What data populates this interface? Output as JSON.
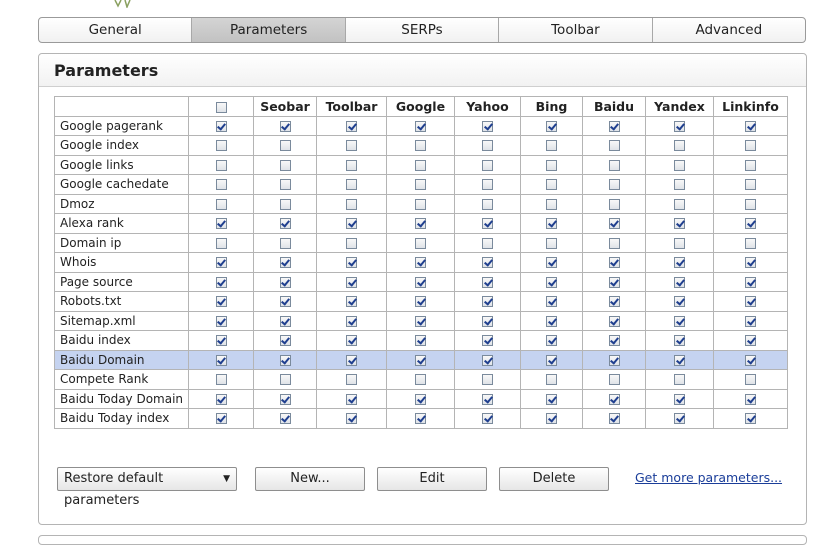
{
  "tabs": [
    {
      "label": "General",
      "active": false
    },
    {
      "label": "Parameters",
      "active": true
    },
    {
      "label": "SERPs",
      "active": false
    },
    {
      "label": "Toolbar",
      "active": false
    },
    {
      "label": "Advanced",
      "active": false
    }
  ],
  "panel": {
    "title": "Parameters"
  },
  "table": {
    "columns": [
      "Seobar",
      "Toolbar",
      "Google",
      "Yahoo",
      "Bing",
      "Baidu",
      "Yandex",
      "Linkinfo"
    ],
    "header_checkbox_checked": false,
    "rows": [
      {
        "name": "Google pagerank",
        "enabled": true,
        "cols": [
          true,
          true,
          true,
          true,
          true,
          true,
          true,
          true
        ]
      },
      {
        "name": "Google index",
        "enabled": false,
        "cols": [
          false,
          false,
          false,
          false,
          false,
          false,
          false,
          false
        ]
      },
      {
        "name": "Google links",
        "enabled": false,
        "cols": [
          false,
          false,
          false,
          false,
          false,
          false,
          false,
          false
        ]
      },
      {
        "name": "Google cachedate",
        "enabled": false,
        "cols": [
          false,
          false,
          false,
          false,
          false,
          false,
          false,
          false
        ]
      },
      {
        "name": "Dmoz",
        "enabled": false,
        "cols": [
          false,
          false,
          false,
          false,
          false,
          false,
          false,
          false
        ]
      },
      {
        "name": "Alexa rank",
        "enabled": true,
        "cols": [
          true,
          true,
          true,
          true,
          true,
          true,
          true,
          true
        ]
      },
      {
        "name": "Domain ip",
        "enabled": false,
        "cols": [
          false,
          false,
          false,
          false,
          false,
          false,
          false,
          false
        ]
      },
      {
        "name": "Whois",
        "enabled": true,
        "cols": [
          true,
          true,
          true,
          true,
          true,
          true,
          true,
          true
        ]
      },
      {
        "name": "Page source",
        "enabled": true,
        "cols": [
          true,
          true,
          true,
          true,
          true,
          true,
          true,
          true
        ]
      },
      {
        "name": "Robots.txt",
        "enabled": true,
        "cols": [
          true,
          true,
          true,
          true,
          true,
          true,
          true,
          true
        ]
      },
      {
        "name": "Sitemap.xml",
        "enabled": true,
        "cols": [
          true,
          true,
          true,
          true,
          true,
          true,
          true,
          true
        ]
      },
      {
        "name": "Baidu index",
        "enabled": true,
        "cols": [
          true,
          true,
          true,
          true,
          true,
          true,
          true,
          true
        ]
      },
      {
        "name": "Baidu Domain",
        "enabled": true,
        "cols": [
          true,
          true,
          true,
          true,
          true,
          true,
          true,
          true
        ],
        "highlighted": true
      },
      {
        "name": "Compete Rank",
        "enabled": false,
        "cols": [
          false,
          false,
          false,
          false,
          false,
          false,
          false,
          false
        ]
      },
      {
        "name": "Baidu Today Domain",
        "enabled": true,
        "cols": [
          true,
          true,
          true,
          true,
          true,
          true,
          true,
          true
        ]
      },
      {
        "name": "Baidu Today index",
        "enabled": true,
        "cols": [
          true,
          true,
          true,
          true,
          true,
          true,
          true,
          true
        ]
      }
    ]
  },
  "buttons": {
    "restore": "Restore default parameters",
    "new": "New...",
    "edit": "Edit",
    "delete": "Delete"
  },
  "links": {
    "more": "Get more parameters..."
  },
  "icons": {
    "dropdown": "caret-down-icon",
    "check": "checkmark-icon"
  },
  "colors": {
    "highlight_row": "#c5d3f0",
    "link": "#1a3d99",
    "active_tab": "#c9c9c9"
  }
}
